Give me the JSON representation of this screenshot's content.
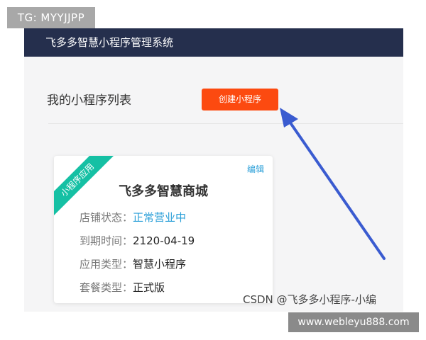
{
  "overlay": {
    "tg_tag": "TG: MYYJJPP",
    "csdn_watermark": "CSDN @飞多多小程序-小编",
    "site_watermark": "www.webleyu888.com"
  },
  "header": {
    "title": "飞多多智慧小程序管理系统",
    "background": "#252f4d"
  },
  "main": {
    "list_title": "我的小程序列表",
    "create_button_label": "创建小程序",
    "create_button_color": "#fc4a10"
  },
  "card": {
    "ribbon": "小程序应用",
    "ribbon_color": "#15c0a4",
    "edit_label": "编辑",
    "name": "飞多多智慧商城",
    "rows": [
      {
        "label": "店铺状态：",
        "value": "正常营业中"
      },
      {
        "label": "到期时间：",
        "value": "2120-04-19"
      },
      {
        "label": "应用类型：",
        "value": "智慧小程序"
      },
      {
        "label": "套餐类型：",
        "value": "正式版"
      }
    ]
  },
  "annotation": {
    "arrow_color": "#3a5bd0",
    "icon": "arrow-up-left-icon"
  }
}
